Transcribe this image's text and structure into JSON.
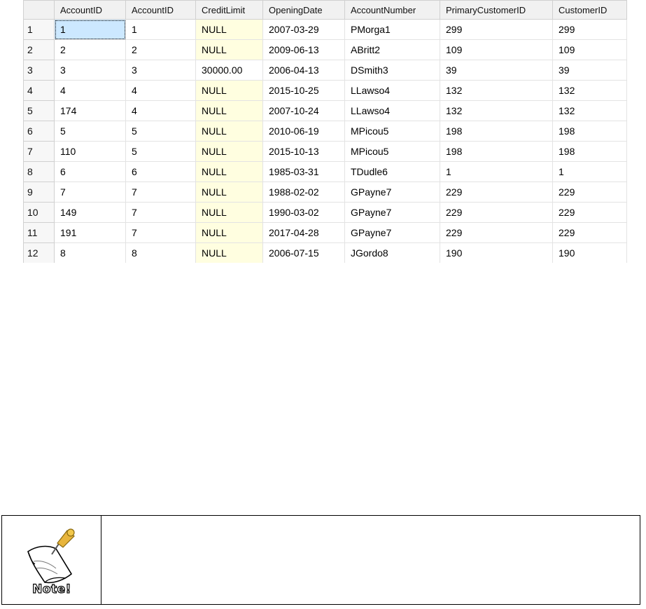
{
  "grid": {
    "columns": [
      "",
      "AccountID",
      "AccountID",
      "CreditLimit",
      "OpeningDate",
      "AccountNumber",
      "PrimaryCustomerID",
      "CustomerID"
    ],
    "rows": [
      {
        "n": "1",
        "acc1": "1",
        "acc2": "1",
        "credit": "NULL",
        "date": "2007-03-29",
        "number": "PMorga1",
        "primary": "299",
        "cust": "299"
      },
      {
        "n": "2",
        "acc1": "2",
        "acc2": "2",
        "credit": "NULL",
        "date": "2009-06-13",
        "number": "ABritt2",
        "primary": "109",
        "cust": "109"
      },
      {
        "n": "3",
        "acc1": "3",
        "acc2": "3",
        "credit": "30000.00",
        "date": "2006-04-13",
        "number": "DSmith3",
        "primary": "39",
        "cust": "39"
      },
      {
        "n": "4",
        "acc1": "4",
        "acc2": "4",
        "credit": "NULL",
        "date": "2015-10-25",
        "number": "LLawso4",
        "primary": "132",
        "cust": "132"
      },
      {
        "n": "5",
        "acc1": "174",
        "acc2": "4",
        "credit": "NULL",
        "date": "2007-10-24",
        "number": "LLawso4",
        "primary": "132",
        "cust": "132"
      },
      {
        "n": "6",
        "acc1": "5",
        "acc2": "5",
        "credit": "NULL",
        "date": "2010-06-19",
        "number": "MPicou5",
        "primary": "198",
        "cust": "198"
      },
      {
        "n": "7",
        "acc1": "110",
        "acc2": "5",
        "credit": "NULL",
        "date": "2015-10-13",
        "number": "MPicou5",
        "primary": "198",
        "cust": "198"
      },
      {
        "n": "8",
        "acc1": "6",
        "acc2": "6",
        "credit": "NULL",
        "date": "1985-03-31",
        "number": "TDudle6",
        "primary": "1",
        "cust": "1"
      },
      {
        "n": "9",
        "acc1": "7",
        "acc2": "7",
        "credit": "NULL",
        "date": "1988-02-02",
        "number": "GPayne7",
        "primary": "229",
        "cust": "229"
      },
      {
        "n": "10",
        "acc1": "149",
        "acc2": "7",
        "credit": "NULL",
        "date": "1990-03-02",
        "number": "GPayne7",
        "primary": "229",
        "cust": "229"
      },
      {
        "n": "11",
        "acc1": "191",
        "acc2": "7",
        "credit": "NULL",
        "date": "2017-04-28",
        "number": "GPayne7",
        "primary": "229",
        "cust": "229"
      },
      {
        "n": "12",
        "acc1": "8",
        "acc2": "8",
        "credit": "NULL",
        "date": "2006-07-15",
        "number": "JGordo8",
        "primary": "190",
        "cust": "190"
      }
    ],
    "null_value": "NULL",
    "selected_cell": {
      "row": 0,
      "column": "acc1"
    }
  },
  "note": {
    "icon": "note-pin-icon",
    "label": "Note!",
    "text": ""
  },
  "colors": {
    "null_cell_bg": "#fffee0",
    "selected_cell_bg": "#cce8ff",
    "header_bg": "#f1f1f1"
  }
}
